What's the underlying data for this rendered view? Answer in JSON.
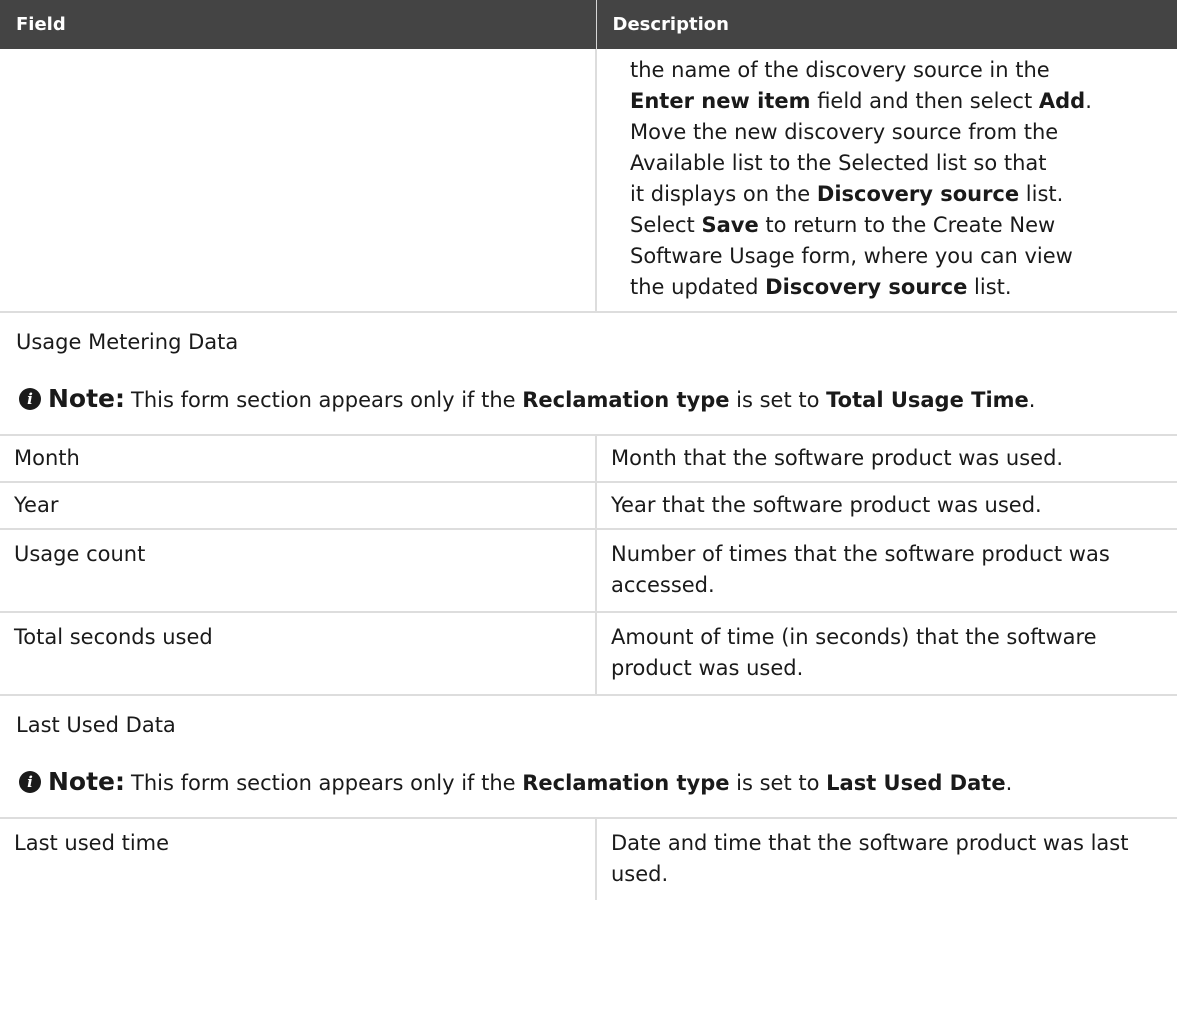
{
  "table": {
    "headers": {
      "field": "Field",
      "description": "Description"
    },
    "continuation": {
      "lines": [
        {
          "pre": "the name of the discovery source in the",
          "b1": "",
          "mid": "",
          "b2": "",
          "post": ""
        },
        {
          "pre": "",
          "b1": "Enter new item",
          "mid": " field and then select ",
          "b2": "Add",
          "post": "."
        },
        {
          "pre": "Move the new discovery source from the",
          "b1": "",
          "mid": "",
          "b2": "",
          "post": ""
        },
        {
          "pre": "Available list to the Selected list so that",
          "b1": "",
          "mid": "",
          "b2": "",
          "post": ""
        },
        {
          "pre": "it displays on the ",
          "b1": "Discovery source",
          "mid": " list.",
          "b2": "",
          "post": ""
        },
        {
          "pre": "Select ",
          "b1": "Save",
          "mid": " to return to the Create New",
          "b2": "",
          "post": ""
        },
        {
          "pre": "Software Usage form, where you can view",
          "b1": "",
          "mid": "",
          "b2": "",
          "post": ""
        },
        {
          "pre": "the updated ",
          "b1": "Discovery source",
          "mid": " list.",
          "b2": "",
          "post": ""
        }
      ]
    },
    "sections": [
      {
        "title": "Usage Metering Data",
        "note": {
          "label": "Note:",
          "pre": "This form section appears only if the ",
          "bold1": "Reclamation type",
          "mid": " is set to ",
          "bold2": "Total Usage Time",
          "post": "."
        },
        "rows": [
          {
            "field": "Month",
            "description": "Month that the software product was used."
          },
          {
            "field": "Year",
            "description": "Year that the software product was used."
          },
          {
            "field": "Usage count",
            "description": "Number of times that the software product was accessed."
          },
          {
            "field": "Total seconds used",
            "description": "Amount of time (in seconds) that the software product was used."
          }
        ]
      },
      {
        "title": "Last Used Data",
        "note": {
          "label": "Note:",
          "pre": "This form section appears only if the ",
          "bold1": "Reclamation type",
          "mid": " is set to ",
          "bold2": "Last Used Date",
          "post": "."
        },
        "rows": [
          {
            "field": "Last used time",
            "description": "Date and time that the software product was last used."
          }
        ]
      }
    ]
  }
}
